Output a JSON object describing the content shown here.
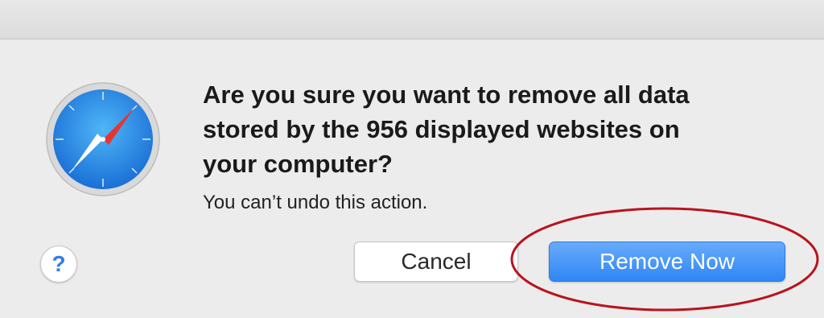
{
  "dialog": {
    "message_lines": [
      "Are you sure you want to remove all data",
      "stored by the 956 displayed websites on",
      "your computer?"
    ],
    "informative_text": "You can’t undo this action.",
    "app_icon": "safari-compass-icon",
    "help_button": {
      "icon": "question-mark-icon",
      "label": "?"
    },
    "buttons": {
      "cancel_label": "Cancel",
      "remove_label": "Remove Now"
    }
  },
  "colors": {
    "dialog_background": "#ececec",
    "primary_button": "#3b8ef7",
    "help_glyph": "#2e7fe8",
    "annotation_circle": "#b8141e"
  }
}
